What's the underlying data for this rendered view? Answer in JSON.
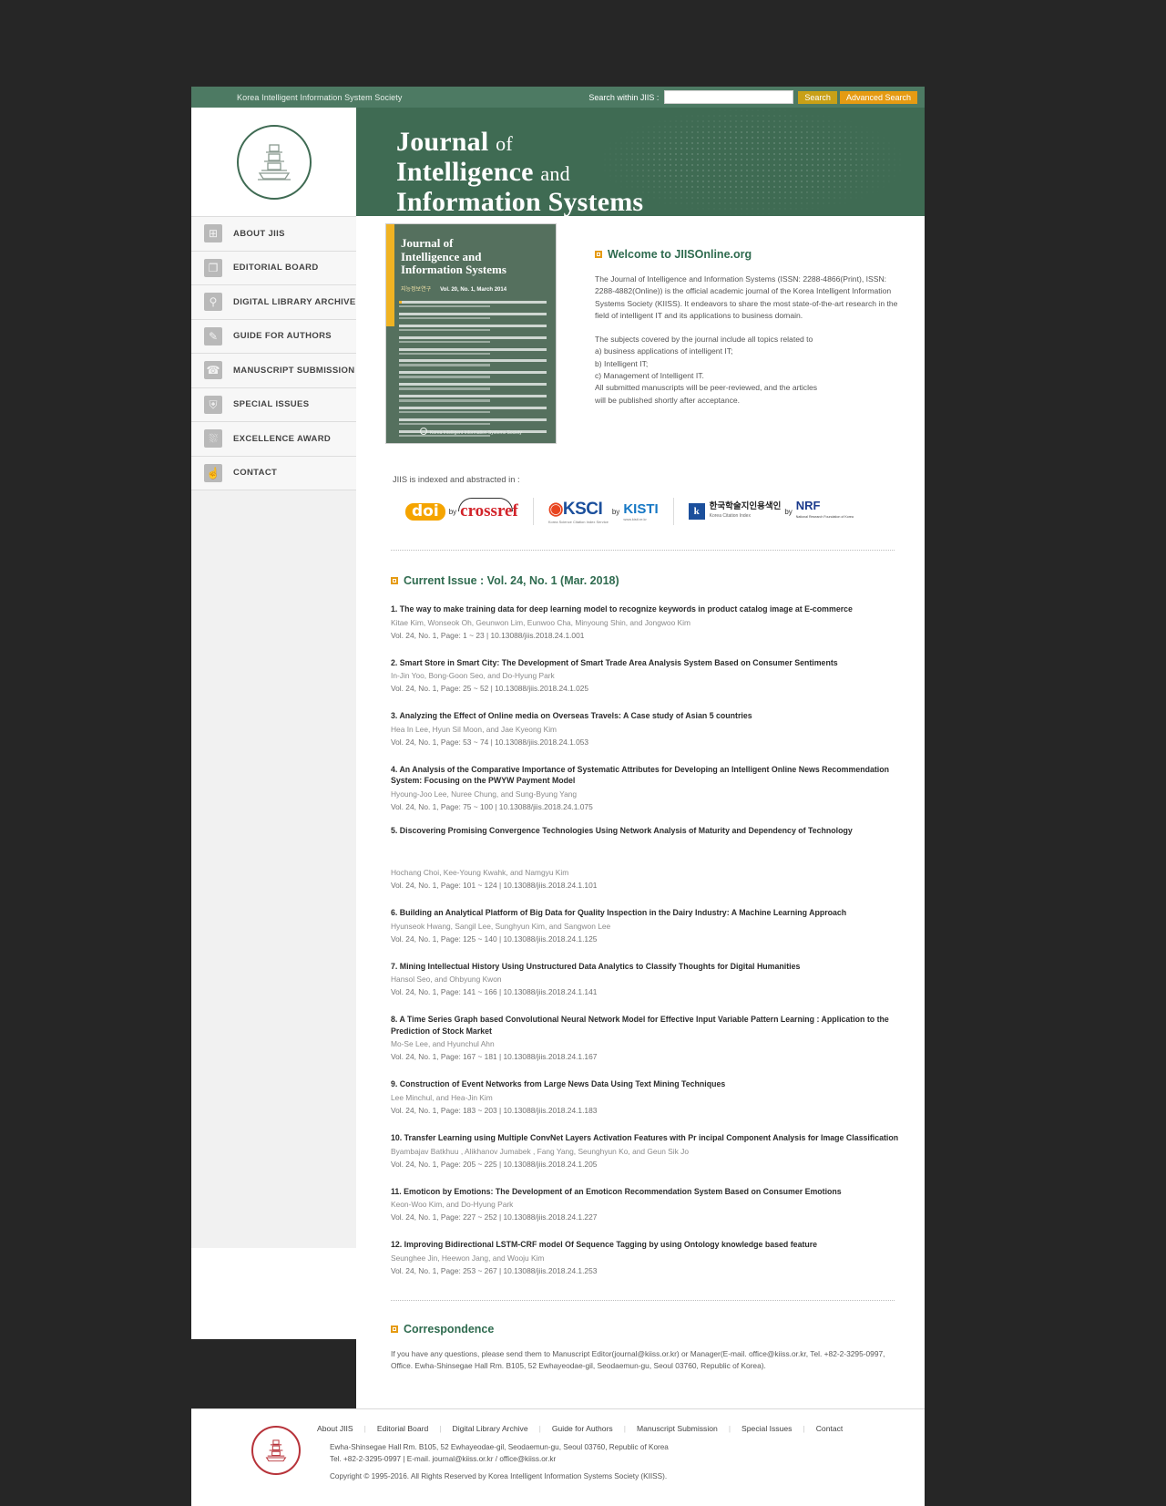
{
  "topbar": {
    "society": "Korea Intelligent Information System Society",
    "search_label": "Search within JIIS :",
    "search_value": "",
    "search_placeholder": "",
    "search_button": "Search",
    "advanced_button": "Advanced Search"
  },
  "masthead": {
    "title_line1_main": "Journal",
    "title_line1_sm": "of",
    "title_line2_main": "Intelligence",
    "title_line2_sm": "and",
    "title_line3_main": "Information Systems"
  },
  "sidebar": {
    "items": [
      {
        "label": "ABOUT JIIS",
        "icon": "building-icon",
        "glyph": "⊞"
      },
      {
        "label": "EDITORIAL BOARD",
        "icon": "monitor-icon",
        "glyph": "❐"
      },
      {
        "label": "DIGITAL LIBRARY ARCHIVE",
        "icon": "magnifier-icon",
        "glyph": "⚲"
      },
      {
        "label": "GUIDE FOR AUTHORS",
        "icon": "pencil-icon",
        "glyph": "✎"
      },
      {
        "label": "MANUSCRIPT SUBMISSION",
        "icon": "headset-icon",
        "glyph": "☎"
      },
      {
        "label": "SPECIAL ISSUES",
        "icon": "shield-icon",
        "glyph": "⛨"
      },
      {
        "label": "EXCELLENCE  AWARD",
        "icon": "trophy-icon",
        "glyph": "⛆"
      },
      {
        "label": "CONTACT",
        "icon": "hand-icon",
        "glyph": "☝"
      }
    ]
  },
  "cover": {
    "title_l1": "Journal of",
    "title_l2": "Intelligence and",
    "title_l3": "Information Systems",
    "korean": "지능정보연구",
    "volume": "Vol. 20, No. 1, March 2014",
    "publisher": "Korea Intelligent Information Systems Society"
  },
  "welcome": {
    "heading": "Welcome to JIISOnline.org",
    "paragraph1": "The Journal of Intelligence and Information Systems (ISSN: 2288-4866(Print), ISSN: 2288-4882(Online)) is the official academic journal of the Korea Intelligent Information Systems Society (KIISS). It endeavors to share the most state-of-the-art research in the field of intelligent IT and its applications to business domain.",
    "paragraph2_line1": "The subjects covered by the journal include all topics related to",
    "paragraph2_line2": "a) business applications of intelligent IT;",
    "paragraph2_line3": "b) Intelligent IT;",
    "paragraph2_line4": "c) Management of Intelligent IT.",
    "paragraph2_line5": "All submitted manuscripts will be peer-reviewed, and the articles",
    "paragraph2_line6": "will be published shortly after acceptance."
  },
  "indexing": {
    "label": "JIIS is indexed and abstracted in :",
    "logos": [
      {
        "name": "doi-crossref-logo",
        "primary": "doi",
        "by": "by",
        "secondary": "crossref"
      },
      {
        "name": "ksci-kisti-logo",
        "primary": "KSCI",
        "primary_sub": "Korea Science Citation Index Service",
        "by": "by",
        "secondary": "KISTI",
        "secondary_sub": "www.kisti.re.kr"
      },
      {
        "name": "kci-nrf-logo",
        "primary": "한국학술지인용색인",
        "primary_sub": "Korea Citation Index",
        "by": "by",
        "secondary": "NRF",
        "secondary_sub": "National Research Foundation of Korea"
      }
    ]
  },
  "current_issue": {
    "heading": "Current Issue : Vol. 24, No. 1 (Mar. 2018)",
    "articles": [
      {
        "title": "1. The way to make training data for deep learning model to recognize keywords in product catalog image at E-commerce",
        "authors": "Kitae Kim, Wonseok Oh, Geunwon Lim, Eunwoo Cha, Minyoung Shin, and Jongwoo Kim",
        "meta": "Vol. 24, No. 1, Page: 1 ~ 23 | 10.13088/jiis.2018.24.1.001"
      },
      {
        "title": "2. Smart Store in Smart City: The Development of Smart Trade Area Analysis System Based on Consumer Sentiments",
        "authors": "In-Jin Yoo, Bong-Goon Seo, and Do-Hyung Park",
        "meta": "Vol. 24, No. 1, Page: 25 ~ 52 | 10.13088/jiis.2018.24.1.025"
      },
      {
        "title": "3. Analyzing the Effect of Online media on Overseas Travels: A Case study of Asian 5 countries",
        "authors": "Hea In Lee, Hyun Sil Moon, and Jae Kyeong Kim",
        "meta": "Vol. 24, No. 1, Page: 53 ~ 74 | 10.13088/jiis.2018.24.1.053"
      },
      {
        "title": "4. An Analysis of the Comparative Importance of Systematic Attributes for Developing an Intelligent Online News Recommendation System: Focusing on the PWYW Payment Model",
        "authors": "Hyoung-Joo Lee, Nuree Chung, and Sung-Byung Yang",
        "meta": "Vol. 24, No. 1, Page: 75 ~ 100 | 10.13088/jiis.2018.24.1.075"
      },
      {
        "title": "5. Discovering Promising Convergence Technologies Using Network Analysis of Maturity and Dependency of Technology",
        "authors": "Hochang Choi, Kee-Young Kwahk, and Namgyu Kim",
        "meta": "Vol. 24, No. 1, Page: 101 ~ 124 | 10.13088/jiis.2018.24.1.101"
      },
      {
        "title": "6. Building an Analytical Platform of Big Data for Quality Inspection in the Dairy Industry: A Machine Learning Approach",
        "authors": "Hyunseok Hwang, Sangil Lee, Sunghyun Kim, and Sangwon Lee",
        "meta": "Vol. 24, No. 1, Page: 125 ~ 140 | 10.13088/jiis.2018.24.1.125"
      },
      {
        "title": "7. Mining Intellectual History Using Unstructured Data Analytics to Classify Thoughts for Digital Humanities",
        "authors": "Hansol Seo, and Ohbyung Kwon",
        "meta": "Vol. 24, No. 1, Page: 141 ~ 166 | 10.13088/jiis.2018.24.1.141"
      },
      {
        "title": "8. A Time Series Graph based Convolutional Neural Network Model for Effective Input Variable Pattern Learning : Application to the Prediction of Stock Market",
        "authors": "Mo-Se Lee, and Hyunchul Ahn",
        "meta": "Vol. 24, No. 1, Page: 167 ~ 181 | 10.13088/jiis.2018.24.1.167"
      },
      {
        "title": "9. Construction of Event Networks from Large News Data Using Text Mining Techniques",
        "authors": "Lee Minchul, and Hea-Jin Kim",
        "meta": "Vol. 24, No. 1, Page: 183 ~ 203 | 10.13088/jiis.2018.24.1.183"
      },
      {
        "title": "10. Transfer Learning using Multiple ConvNet Layers Activation Features with Pr incipal Component Analysis for Image Classification",
        "authors": "Byambajav Batkhuu , Alikhanov Jumabek , Fang Yang, Seunghyun Ko, and Geun Sik Jo",
        "meta": "Vol. 24, No. 1, Page: 205 ~ 225 | 10.13088/jiis.2018.24.1.205"
      },
      {
        "title": "11. Emoticon by Emotions: The Development of an Emoticon Recommendation System Based on Consumer Emotions",
        "authors": "Keon-Woo Kim, and Do-Hyung Park",
        "meta": "Vol. 24, No. 1, Page: 227 ~ 252 | 10.13088/jiis.2018.24.1.227"
      },
      {
        "title": "12. Improving Bidirectional LSTM-CRF model Of Sequence Tagging by using Ontology knowledge based feature",
        "authors": "Seunghee Jin, Heewon Jang, and Wooju Kim",
        "meta": "Vol. 24, No. 1, Page: 253 ~ 267 | 10.13088/jiis.2018.24.1.253"
      }
    ]
  },
  "correspondence": {
    "heading": "Correspondence",
    "body": "If you have any questions, please send them to Manuscript Editor(journal@kiiss.or.kr) or Manager(E-mail. office@kiiss.or.kr, Tel. +82-2-3295-0997, Office. Ewha-Shinsegae Hall Rm. B105, 52 Ewhayeodae-gil, Seodaemun-gu, Seoul 03760, Republic of Korea)."
  },
  "footer": {
    "links": [
      "About JIIS",
      "Editorial Board",
      "Digital Library Archive",
      "Guide for Authors",
      "Manuscript Submission",
      "Special Issues",
      "Contact"
    ],
    "address": "Ewha-Shinsegae Hall Rm. B105, 52 Ewhayeodae-gil, Seodaemun-gu, Seoul 03760, Republic of Korea",
    "contact": "Tel. +82-2-3295-0997 | E-mail. journal@kiiss.or.kr / office@kiiss.or.kr",
    "copyright": "Copyright © 1995-2016. All Rights Reserved by Korea Intelligent Information Systems Society (KIISS)."
  },
  "colors": {
    "brand_green": "#3f6b53",
    "topbar_green": "#4d7a63",
    "accent_orange": "#e59b13",
    "search_gold": "#c8a017",
    "heading_green": "#2f6b4f"
  }
}
